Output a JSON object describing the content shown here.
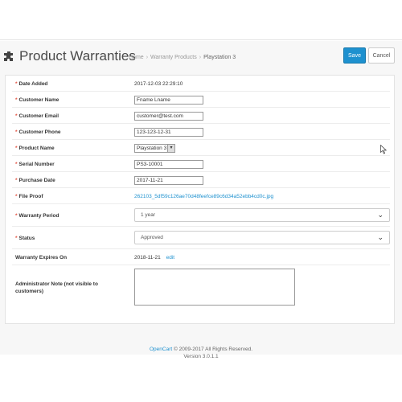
{
  "header": {
    "title": "Product Warranties",
    "logo_icon": "puzzle-icon",
    "breadcrumbs": [
      "Home",
      "Warranty Products",
      "Playstation 3"
    ],
    "separator": "›"
  },
  "actions": {
    "save_label": "Save",
    "cancel_label": "Cancel"
  },
  "form": {
    "date_added": {
      "label": "Date Added",
      "value": "2017-12-03 22:29:10"
    },
    "customer_name": {
      "label": "Customer Name",
      "value": "Fname Lname"
    },
    "customer_email": {
      "label": "Customer Email",
      "value": "customer@test.com"
    },
    "customer_phone": {
      "label": "Customer Phone",
      "value": "123-123-12-31"
    },
    "product_name": {
      "label": "Product Name",
      "value": "Playstation 3"
    },
    "serial_number": {
      "label": "Serial Number",
      "value": "PS3-10001"
    },
    "purchase_date": {
      "label": "Purchase Date",
      "value": "2017-11-21"
    },
    "file_proof": {
      "label": "File Proof",
      "value": "262103_5df59c126ae70d48feefce89c6d34a52ebb4cd0c.jpg"
    },
    "warranty_period": {
      "label": "Warranty Period",
      "value": "1 year"
    },
    "status": {
      "label": "Status",
      "value": "Approved"
    },
    "warranty_expires": {
      "label": "Warranty Expires On",
      "value": "2018-11-21",
      "edit_label": "edit"
    },
    "admin_note": {
      "label": "Administrator Note (not visible to customers)",
      "value": ""
    },
    "required_mark": "*"
  },
  "footer": {
    "brand": "OpenCart",
    "copyright": "© 2009-2017 All Rights Reserved.",
    "version": "Version 3.0.1.1"
  },
  "colors": {
    "accent": "#1e91cf",
    "required": "#e3503e"
  }
}
